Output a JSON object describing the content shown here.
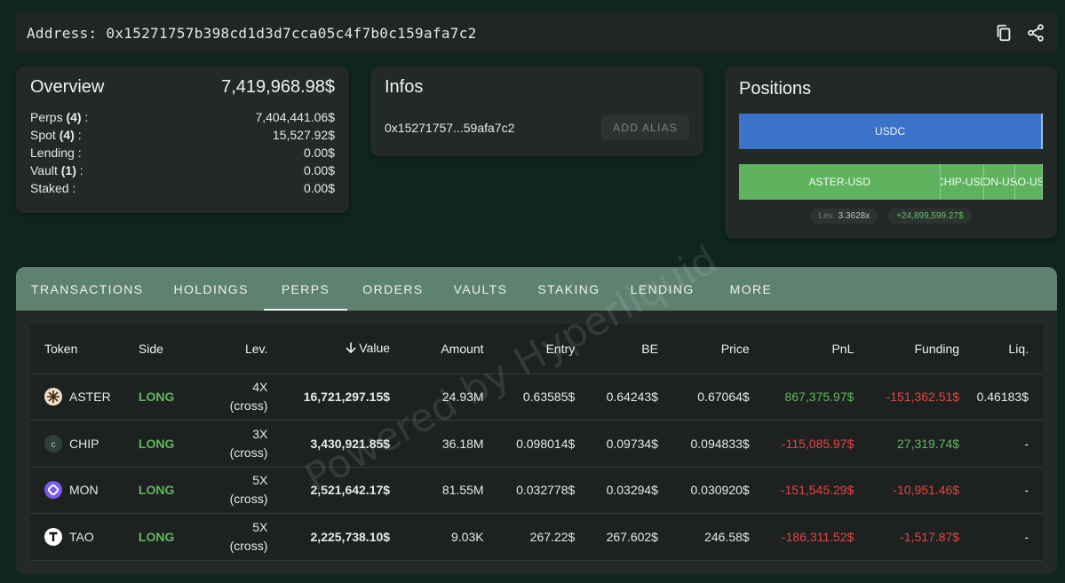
{
  "address_bar": {
    "label": "Address: 0x15271757b398cd1d3d7cca05c4f7b0c159afa7c2",
    "copy_icon": "copy-icon",
    "share_icon": "share-icon"
  },
  "overview": {
    "title": "Overview",
    "total": "7,419,968.98$",
    "rows": [
      {
        "label": "Perps",
        "count": "(4)",
        "suffix": " :",
        "value": "7,404,441.06$"
      },
      {
        "label": "Spot",
        "count": "(4)",
        "suffix": " :",
        "value": "15,527.92$"
      },
      {
        "label": "Lending :",
        "count": "",
        "suffix": "",
        "value": "0.00$"
      },
      {
        "label": "Vault",
        "count": "(1)",
        "suffix": " :",
        "value": "0.00$"
      },
      {
        "label": "Staked :",
        "count": "",
        "suffix": "",
        "value": "0.00$"
      }
    ]
  },
  "infos": {
    "title": "Infos",
    "short_address": "0x15271757...59afa7c2",
    "alias_button": "ADD ALIAS"
  },
  "positions": {
    "title": "Positions",
    "usdc_label": "USDC",
    "segments": [
      {
        "label": "ASTER-USD",
        "share": 0.67
      },
      {
        "label": "CHIP-USD",
        "share": 0.14
      },
      {
        "label": "MON-USD",
        "share": 0.1
      },
      {
        "label": "TAO-USD",
        "share": 0.09
      }
    ],
    "lev_label": "Lev.",
    "lev_value": "3.3628x",
    "pnl_chip": "+24,899,599.27$"
  },
  "tabs": [
    {
      "label": "TRANSACTIONS",
      "active": false
    },
    {
      "label": "HOLDINGS",
      "active": false
    },
    {
      "label": "PERPS",
      "active": true
    },
    {
      "label": "ORDERS",
      "active": false
    },
    {
      "label": "VAULTS",
      "active": false
    },
    {
      "label": "STAKING",
      "active": false
    },
    {
      "label": "LENDING",
      "active": false
    },
    {
      "label": "MORE",
      "active": false
    }
  ],
  "table": {
    "headers": {
      "token": "Token",
      "side": "Side",
      "lev": "Lev.",
      "value": "Value",
      "amount": "Amount",
      "entry": "Entry",
      "be": "BE",
      "price": "Price",
      "pnl": "PnL",
      "funding": "Funding",
      "liq": "Liq."
    },
    "sort_icon": "arrow-down-icon",
    "rows": [
      {
        "token": "ASTER",
        "icon": "aster-token-icon",
        "side": "LONG",
        "lev": "4X",
        "lev_mode": "(cross)",
        "value": "16,721,297.15$",
        "amount": "24.93M",
        "entry": "0.63585$",
        "be": "0.64243$",
        "price": "0.67064$",
        "pnl": "867,375.97$",
        "funding": "-151,362.51$",
        "liq": "0.46183$"
      },
      {
        "token": "CHIP",
        "icon": "chip-token-icon",
        "side": "LONG",
        "lev": "3X",
        "lev_mode": "(cross)",
        "value": "3,430,921.85$",
        "amount": "36.18M",
        "entry": "0.098014$",
        "be": "0.09734$",
        "price": "0.094833$",
        "pnl": "-115,085.97$",
        "funding": "27,319.74$",
        "liq": "-"
      },
      {
        "token": "MON",
        "icon": "mon-token-icon",
        "side": "LONG",
        "lev": "5X",
        "lev_mode": "(cross)",
        "value": "2,521,642.17$",
        "amount": "81.55M",
        "entry": "0.032778$",
        "be": "0.03294$",
        "price": "0.030920$",
        "pnl": "-151,545.29$",
        "funding": "-10,951.46$",
        "liq": "-"
      },
      {
        "token": "TAO",
        "icon": "tao-token-icon",
        "side": "LONG",
        "lev": "5X",
        "lev_mode": "(cross)",
        "value": "2,225,738.10$",
        "amount": "9.03K",
        "entry": "267.22$",
        "be": "267.602$",
        "price": "246.58$",
        "pnl": "-186,311.52$",
        "funding": "-1,517.87$",
        "liq": "-"
      }
    ]
  },
  "watermark": "Powered by Hyperliquid",
  "colors": {
    "accent_tab": "#5e8172",
    "long": "#63b65e",
    "negative": "#e34545",
    "usdc": "#3b73c8",
    "perp_segment": "#5fb35f"
  }
}
